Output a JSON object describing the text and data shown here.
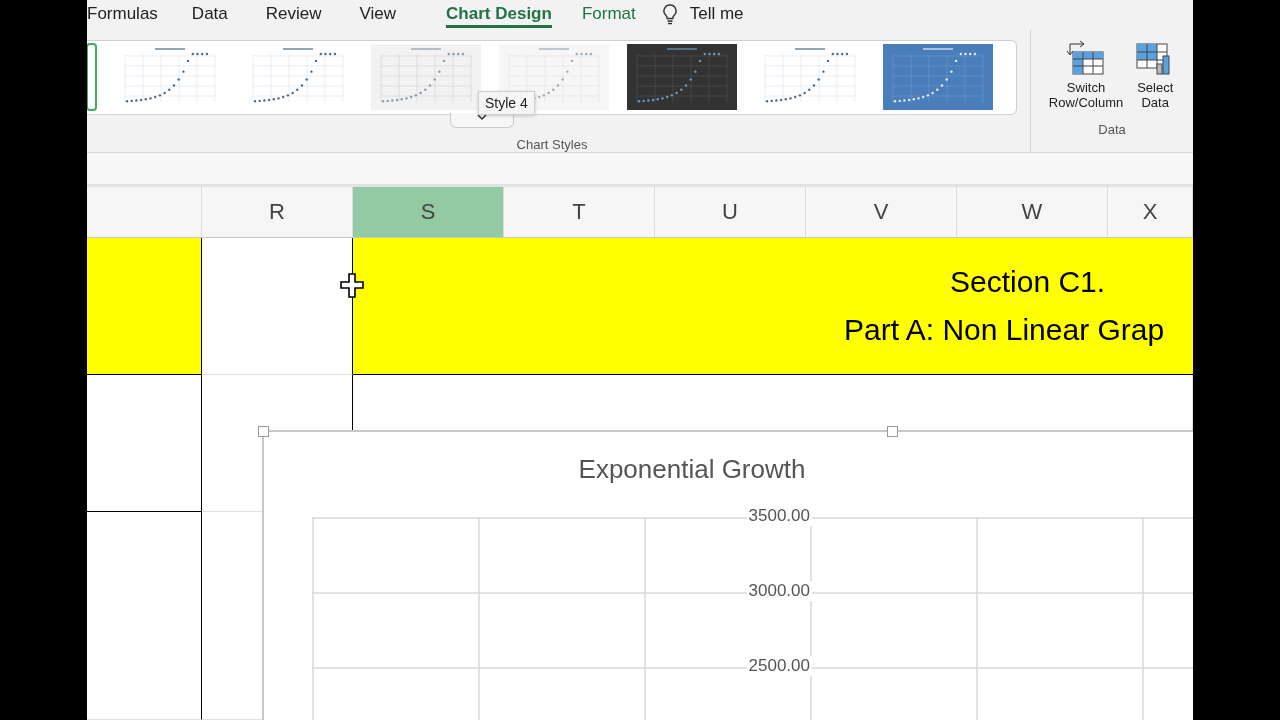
{
  "ribbon_tabs": [
    {
      "label": "Formulas",
      "kind": "normal",
      "selected": false
    },
    {
      "label": "Data",
      "kind": "normal",
      "selected": false
    },
    {
      "label": "Review",
      "kind": "normal",
      "selected": false
    },
    {
      "label": "View",
      "kind": "normal",
      "selected": false
    },
    {
      "label": "Chart Design",
      "kind": "contextual",
      "selected": true
    },
    {
      "label": "Format",
      "kind": "contextual",
      "selected": false
    }
  ],
  "tell_me": "Tell me",
  "chart_styles": {
    "label": "Chart Styles",
    "tooltip": "Style 4",
    "styles": [
      {
        "kind": "partial",
        "selected": true
      },
      {
        "kind": "light",
        "selected": false
      },
      {
        "kind": "light",
        "selected": false
      },
      {
        "kind": "gray",
        "selected": false
      },
      {
        "kind": "faded",
        "selected": false
      },
      {
        "kind": "dark",
        "selected": false
      },
      {
        "kind": "light",
        "selected": false
      },
      {
        "kind": "blue",
        "selected": false
      }
    ]
  },
  "data_group": {
    "label": "Data",
    "buttons": [
      {
        "kind": "switch",
        "label": "Switch\nRow/Column"
      },
      {
        "kind": "select",
        "label": "Select\nData"
      }
    ]
  },
  "columns": [
    {
      "selected": false
    },
    {
      "label": "R",
      "selected": false
    },
    {
      "label": "S",
      "selected": true
    },
    {
      "label": "T",
      "selected": false
    },
    {
      "label": "U",
      "selected": false
    },
    {
      "label": "V",
      "selected": false
    },
    {
      "label": "W",
      "selected": false
    },
    {
      "label": "X",
      "selected": false
    }
  ],
  "header_cell": {
    "lines": [
      "Section C1.",
      "Part A: Non Linear Grap"
    ]
  },
  "chart": {
    "title": "Exponential Growth",
    "y_tick_labels": [
      "3500.00",
      "3000.00",
      "2500.00"
    ]
  }
}
